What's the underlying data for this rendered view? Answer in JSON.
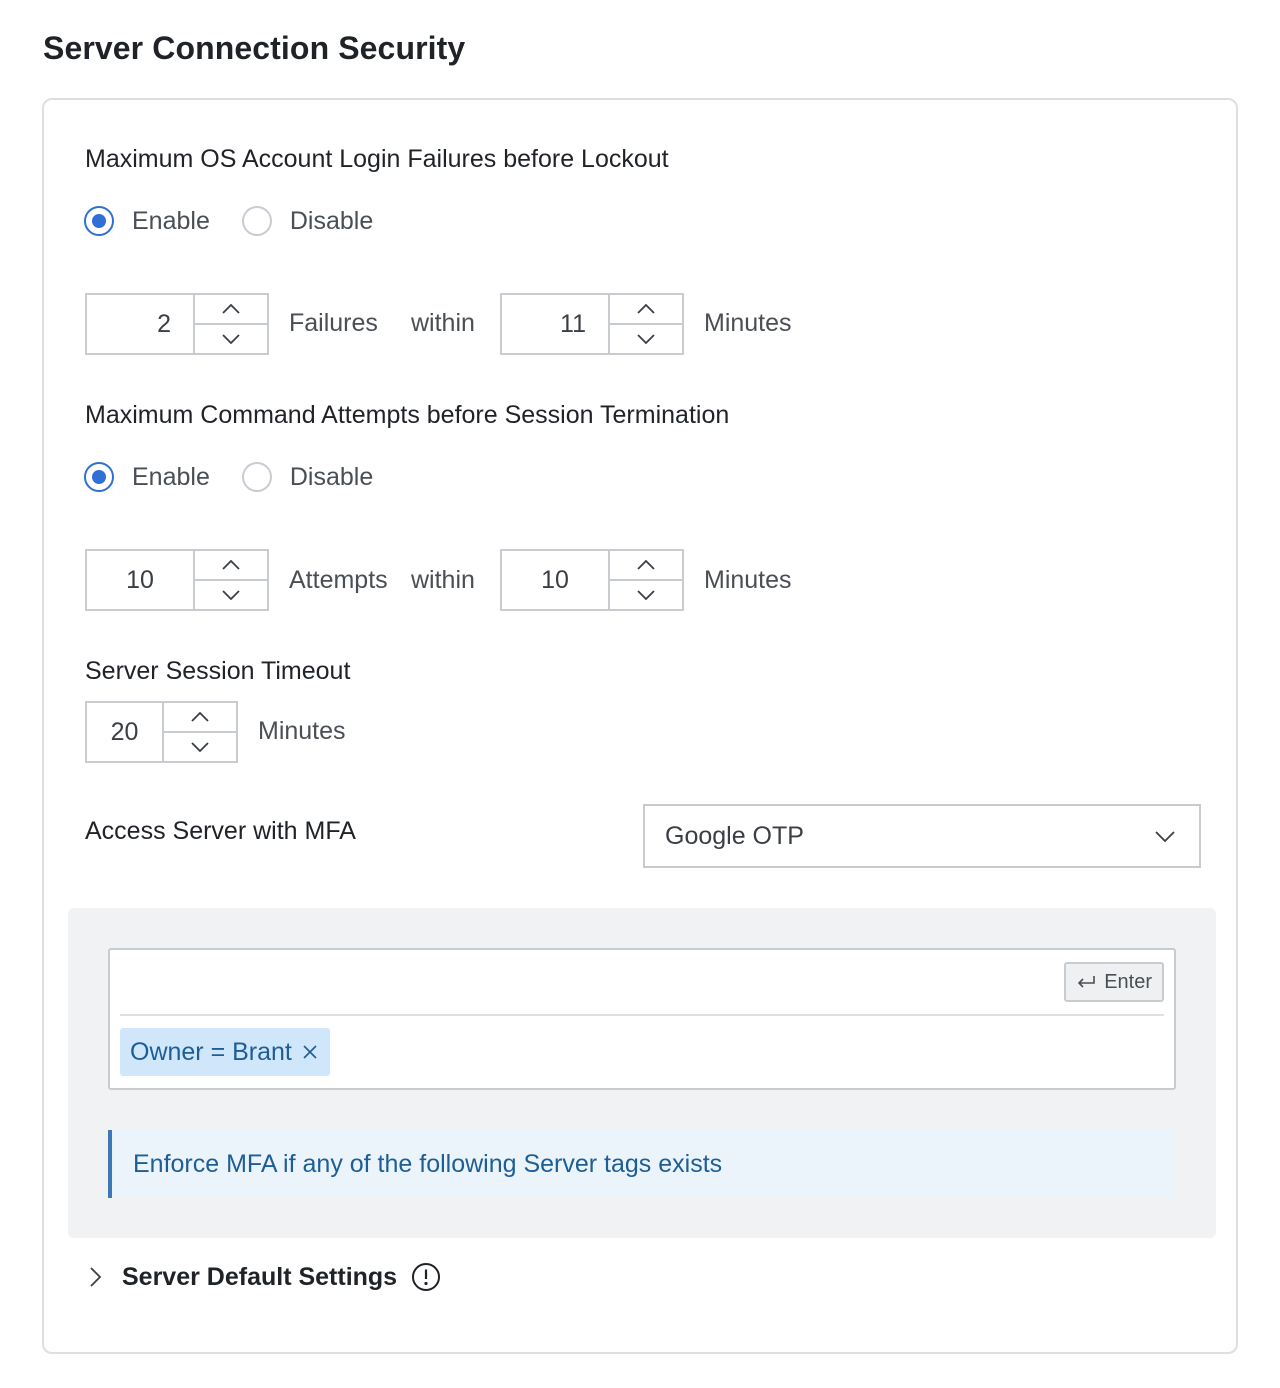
{
  "page": {
    "title": "Server Connection Security"
  },
  "login_failures": {
    "label": "Maximum OS Account Login Failures before Lockout",
    "enable_label": "Enable",
    "disable_label": "Disable",
    "selected": "enable",
    "count_value": "2",
    "count_unit": "Failures",
    "within_label": "within",
    "minutes_value": "11",
    "minutes_unit": "Minutes"
  },
  "command_attempts": {
    "label": "Maximum Command Attempts before Session Termination",
    "enable_label": "Enable",
    "disable_label": "Disable",
    "selected": "enable",
    "count_value": "10",
    "count_unit": "Attempts",
    "within_label": "within",
    "minutes_value": "10",
    "minutes_unit": "Minutes"
  },
  "session_timeout": {
    "label": "Server Session Timeout",
    "value": "20",
    "unit": "Minutes"
  },
  "mfa": {
    "label": "Access Server with MFA",
    "selected_option": "Google OTP",
    "tag_input": {
      "value": "",
      "placeholder": ""
    },
    "enter_button_label": "Enter",
    "tags": [
      {
        "label": "Owner = Brant"
      }
    ],
    "note": "Enforce MFA if any of the following Server tags exists"
  },
  "defaults": {
    "label": "Server Default Settings",
    "expanded": false
  },
  "icons": {
    "stepper_up": "chevron-up-icon",
    "stepper_down": "chevron-down-icon",
    "select_caret": "chevron-down-icon",
    "enter": "enter-return-icon",
    "remove_tag": "close-icon",
    "expand": "chevron-right-icon",
    "info": "info-circle-icon"
  },
  "colors": {
    "accent": "#2f6fd6",
    "tag_bg": "#cfe6fb",
    "tag_text": "#1e5e96",
    "note_border": "#3b78b5",
    "panel_bg": "#f1f2f4"
  }
}
